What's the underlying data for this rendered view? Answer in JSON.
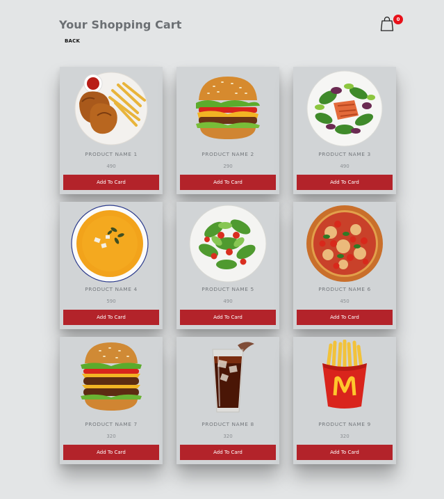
{
  "header": {
    "title": "Your Shopping Cart",
    "back_label": "BACK",
    "cart_count": "0",
    "cart_icon": "shopping-bag-icon",
    "badge_color": "#e8111a"
  },
  "button_color": "#b3232a",
  "products": [
    {
      "name": "PRODUCT NAME 1",
      "price": "490",
      "button": "Add To Card",
      "image": "fried-chicken-and-fries"
    },
    {
      "name": "PRODUCT NAME 2",
      "price": "290",
      "button": "Add To Card",
      "image": "burger"
    },
    {
      "name": "PRODUCT NAME 3",
      "price": "490",
      "button": "Add To Card",
      "image": "salmon-salad"
    },
    {
      "name": "PRODUCT NAME 4",
      "price": "590",
      "button": "Add To Card",
      "image": "pumpkin-soup"
    },
    {
      "name": "PRODUCT NAME 5",
      "price": "490",
      "button": "Add To Card",
      "image": "green-salad"
    },
    {
      "name": "PRODUCT NAME 6",
      "price": "450",
      "button": "Add To Card",
      "image": "pizza"
    },
    {
      "name": "PRODUCT NAME 7",
      "price": "320",
      "button": "Add To Card",
      "image": "double-burger"
    },
    {
      "name": "PRODUCT NAME 8",
      "price": "320",
      "button": "Add To Card",
      "image": "cola-glass"
    },
    {
      "name": "PRODUCT NAME 9",
      "price": "320",
      "button": "Add To Card",
      "image": "mcdonalds-fries"
    }
  ]
}
